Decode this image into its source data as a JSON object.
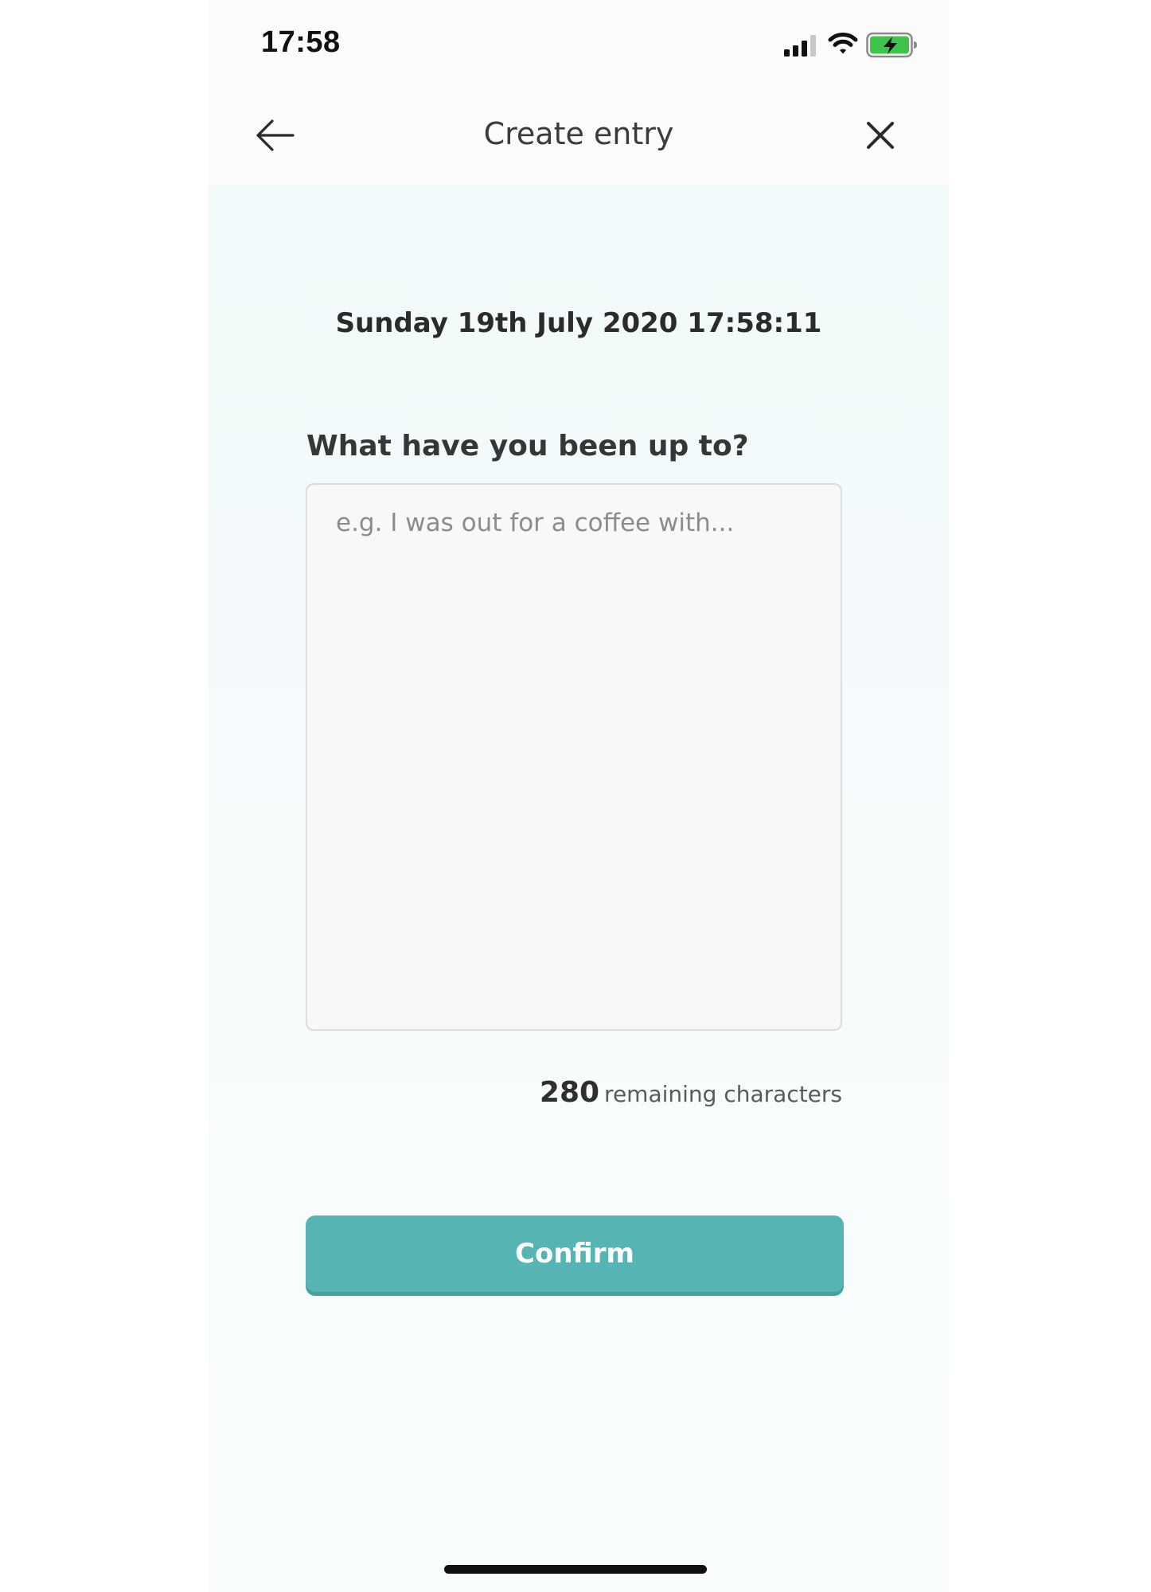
{
  "status_bar": {
    "time": "17:58",
    "icons": [
      "signal-icon",
      "wifi-icon",
      "battery-charging-icon"
    ]
  },
  "nav": {
    "title": "Create entry",
    "back_icon": "arrow-left-icon",
    "close_icon": "close-icon"
  },
  "entry": {
    "date": "Sunday 19th July 2020 17:58:11",
    "question": "What have you been up to?",
    "input_value": "",
    "placeholder": "e.g. I was out for a coffee with...",
    "remaining_count": "280",
    "remaining_label": "remaining characters"
  },
  "actions": {
    "confirm_label": "Confirm"
  },
  "colors": {
    "accent": "#56b5b3",
    "background": "#f4fafb",
    "text": "#333333"
  }
}
